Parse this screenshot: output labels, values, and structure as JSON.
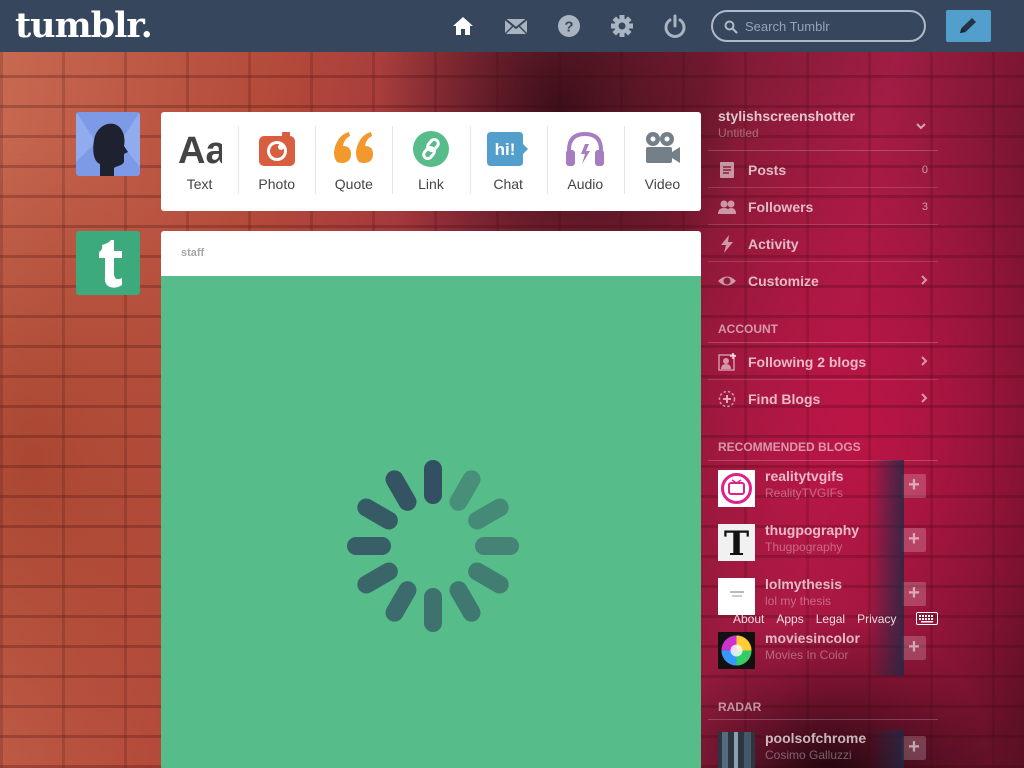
{
  "header": {
    "logo": "tumblr.",
    "search_placeholder": "Search Tumblr",
    "nav_icons": [
      "home-icon",
      "mail-icon",
      "help-icon",
      "gear-icon",
      "power-icon"
    ],
    "brand_color": "#36465d",
    "compose_color": "#529ecc"
  },
  "post_types": [
    {
      "label": "Text",
      "icon": "text-icon",
      "color": "#444444"
    },
    {
      "label": "Photo",
      "icon": "camera-icon",
      "color": "#d95e40"
    },
    {
      "label": "Quote",
      "icon": "quote-icon",
      "color": "#f2992e"
    },
    {
      "label": "Link",
      "icon": "link-icon",
      "color": "#56bc8a"
    },
    {
      "label": "Chat",
      "icon": "chat-icon",
      "color": "#529ecc"
    },
    {
      "label": "Audio",
      "icon": "headphones-icon",
      "color": "#a77dc2"
    },
    {
      "label": "Video",
      "icon": "video-camera-icon",
      "color": "#748089"
    }
  ],
  "post": {
    "author": "staff",
    "background_color": "#56bc8a"
  },
  "sidebar": {
    "blog_name": "stylishscreenshotter",
    "blog_title": "Untitled",
    "items": [
      {
        "label": "Posts",
        "count": "0",
        "icon": "posts-icon"
      },
      {
        "label": "Followers",
        "count": "3",
        "icon": "followers-icon"
      },
      {
        "label": "Activity",
        "icon": "activity-icon"
      },
      {
        "label": "Customize",
        "icon": "eye-icon"
      }
    ],
    "account_heading": "ACCOUNT",
    "account_items": [
      {
        "label": "Following 2 blogs",
        "icon": "following-icon"
      },
      {
        "label": "Find Blogs",
        "icon": "find-blogs-icon"
      }
    ],
    "recommended_heading": "RECOMMENDED BLOGS",
    "recommended": [
      {
        "name": "realitytvgifs",
        "title": "RealityTVGIFs"
      },
      {
        "name": "thugpography",
        "title": "Thugpography"
      },
      {
        "name": "lolmythesis",
        "title": "lol my thesis"
      },
      {
        "name": "moviesincolor",
        "title": "Movies In Color"
      }
    ],
    "footer_links": [
      "About",
      "Apps",
      "Legal",
      "Privacy"
    ],
    "radar_heading": "RADAR",
    "radar": {
      "name": "poolsofchrome",
      "title": "Cosimo Galluzzi"
    }
  }
}
